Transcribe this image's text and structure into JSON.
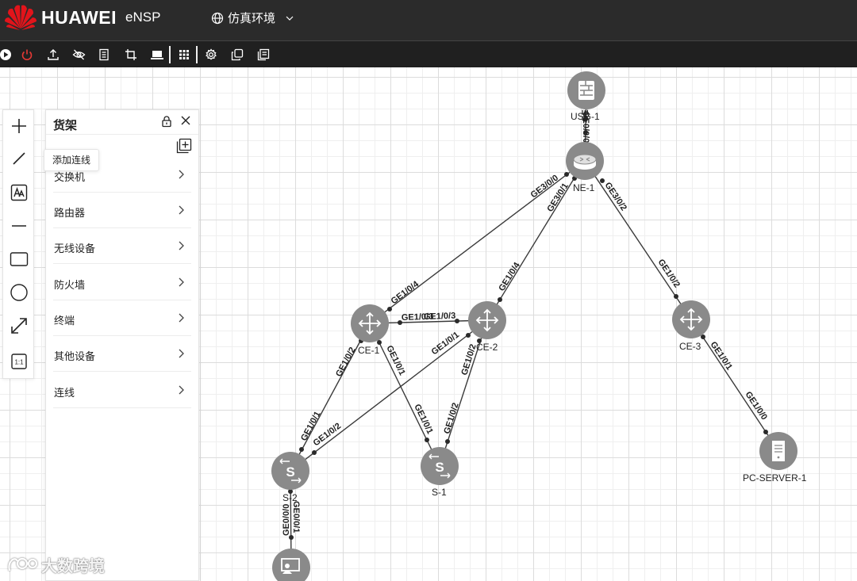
{
  "header": {
    "brand": "HUAWEI",
    "product": "eNSP",
    "env_selector": {
      "label": "仿真环境",
      "icon": "globe-icon",
      "caret": "chevron-down-icon"
    }
  },
  "toolbar": {
    "buttons": [
      {
        "icon": "play-icon"
      },
      {
        "icon": "power-icon",
        "color": "#e53935"
      },
      {
        "icon": "upload-icon"
      },
      {
        "icon": "eye-off-icon"
      },
      {
        "icon": "document-icon"
      },
      {
        "icon": "crop-icon"
      },
      {
        "icon": "laptop-icon"
      },
      {
        "icon": "grid-icon"
      },
      {
        "icon": "gear-icon"
      },
      {
        "icon": "copy-icon"
      },
      {
        "icon": "paste-icon"
      }
    ]
  },
  "left_tools": [
    {
      "icon": "plus-icon"
    },
    {
      "icon": "line-icon"
    },
    {
      "icon": "text-icon"
    },
    {
      "icon": "hline-icon"
    },
    {
      "icon": "rectangle-icon"
    },
    {
      "icon": "circle-icon"
    },
    {
      "icon": "fit-screen-icon"
    },
    {
      "icon": "actual-size-icon",
      "label": "1:1"
    }
  ],
  "tooltip": "添加连线",
  "shelf": {
    "title": "货架",
    "categories": [
      "交换机",
      "路由器",
      "无线设备",
      "防火墙",
      "终端",
      "其他设备",
      "连线"
    ]
  },
  "topology": {
    "nodes": [
      {
        "id": "usg1",
        "label": "USG-1",
        "icon": "firewall-icon"
      },
      {
        "id": "ne1",
        "label": "NE-1",
        "icon": "router-icon"
      },
      {
        "id": "ce1",
        "label": "CE-1",
        "icon": "core-switch-icon"
      },
      {
        "id": "ce2",
        "label": "CE-2",
        "icon": "core-switch-icon"
      },
      {
        "id": "ce3",
        "label": "CE-3",
        "icon": "core-switch-icon"
      },
      {
        "id": "s1",
        "label": "S-1",
        "icon": "switch-icon"
      },
      {
        "id": "s2",
        "label": "S-2",
        "icon": "switch-icon"
      },
      {
        "id": "pcserver1",
        "label": "PC-SERVER-1",
        "icon": "server-icon"
      },
      {
        "id": "pc1",
        "label": "",
        "icon": "pc-icon"
      }
    ],
    "port_labels": [
      "GE0/0/0",
      "GE0/0/0",
      "GE3/0/0",
      "GE3/0/1",
      "GE3/0/2",
      "GE1/0/4",
      "GE1/0/4",
      "GE1/0/3",
      "GE1/0/3",
      "GE1/0/2",
      "GE1/0/1",
      "GE1/0/1",
      "GE1/0/2",
      "GE1/0/2",
      "GE1/0/1",
      "GE1/0/1",
      "GE1/0/2",
      "GE1/0/2",
      "GE1/0/1",
      "GE1/0/0",
      "GE0/0/0",
      "GE0/0/1"
    ]
  },
  "watermark": "大数跨境"
}
